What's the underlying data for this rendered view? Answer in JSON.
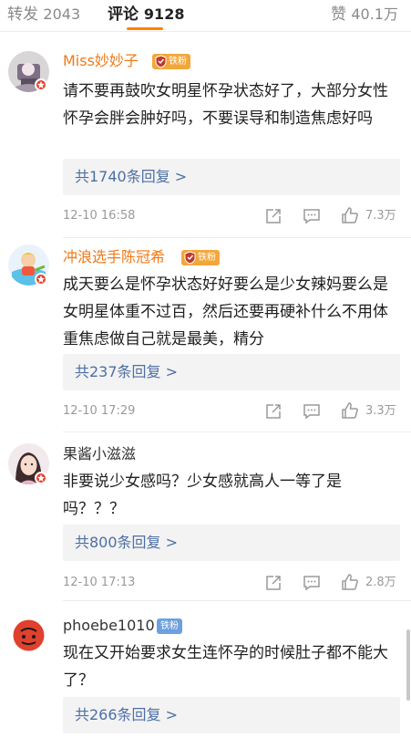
{
  "tabs": {
    "repost_label": "转发",
    "repost_count": "2043",
    "comment_label": "评论",
    "comment_count": "9128",
    "like_label": "赞",
    "like_count": "40.1万"
  },
  "colors": {
    "accent": "#ff8200",
    "username_member": "#ef7a18",
    "reply_link": "#4d6fa5",
    "meta": "#9a9a9a"
  },
  "comments": [
    {
      "username": "Miss妙妙子",
      "badge": "铁粉",
      "badge_icon": "fan-crest-icon",
      "text": "请不要再鼓吹女明星怀孕状态好了，大部分女性怀孕会胖会肿好吗，不要误导和制造焦虑好吗",
      "replies": "共1740条回复 >",
      "time": "12-10 16:58",
      "likes": "7.3万"
    },
    {
      "username": "冲浪选手陈冠希",
      "badge": "铁粉",
      "badge_icon": "fan-crest-icon",
      "text": "成天要么是怀孕状态好好要么是少女辣妈要么是女明星体重不过百，然后还要再硬补什么不用体重焦虑做自己就是最美，精分",
      "replies": "共237条回复 >",
      "time": "12-10 17:29",
      "likes": "3.3万"
    },
    {
      "username": "果酱小滋滋",
      "text": "非要说少女感吗？少女感就高人一等了是吗？？？",
      "replies": "共800条回复 >",
      "time": "12-10 17:13",
      "likes": "2.8万"
    },
    {
      "username": "phoebe1010",
      "badge": "铁粉",
      "text": "现在又开始要求女生连怀孕的时候肚子都不能大了？",
      "replies": "共266条回复 >"
    }
  ]
}
